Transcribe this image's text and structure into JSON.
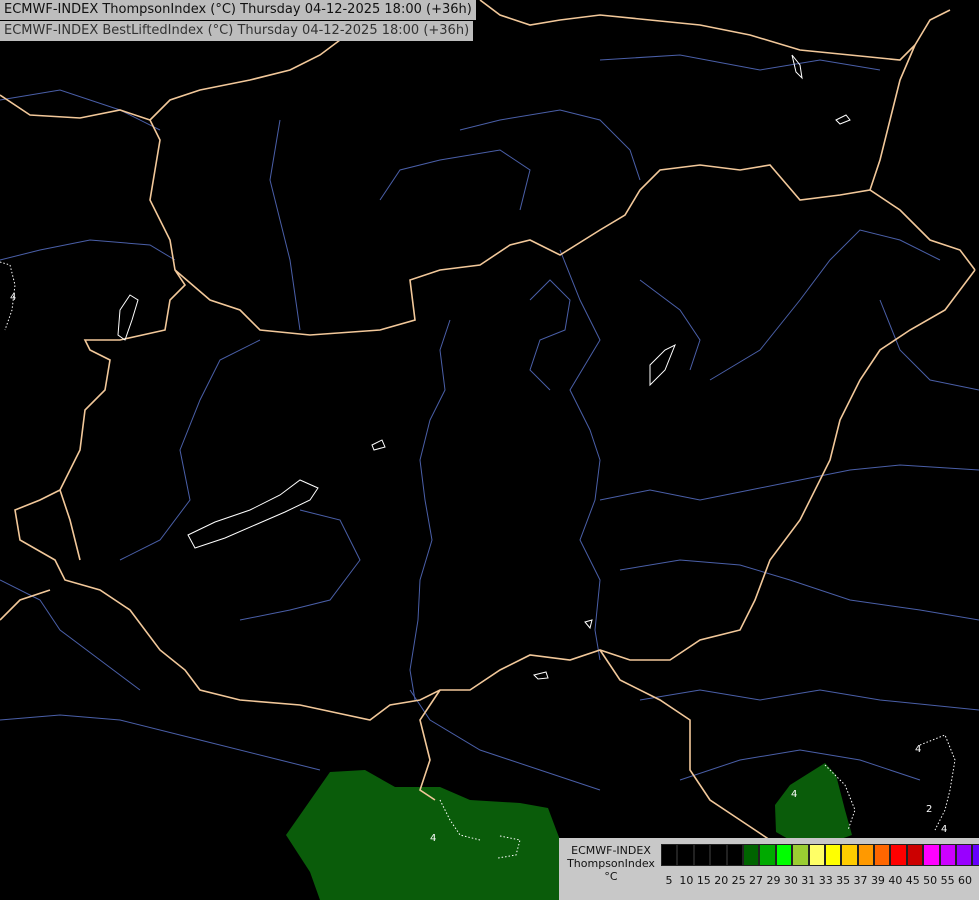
{
  "titles": {
    "line1": "ECMWF-INDEX ThompsonIndex (°C) Thursday 04-12-2025 18:00 (+36h)",
    "line2": "ECMWF-INDEX BestLiftedIndex (°C) Thursday 04-12-2025 18:00 (+36h)"
  },
  "legend": {
    "line1": "ECMWF-INDEX",
    "line2": "ThompsonIndex",
    "line3": "°C",
    "colors": [
      "#000000",
      "#000000",
      "#000000",
      "#000000",
      "#000000",
      "#006400",
      "#00aa00",
      "#00ff00",
      "#9acd32",
      "#ffff66",
      "#ffff00",
      "#ffcc00",
      "#ff9900",
      "#ff6600",
      "#ff0000",
      "#cc0000",
      "#ff00ff",
      "#cc00ff",
      "#9900ff",
      "#6600ff",
      "#0000ff"
    ],
    "ticks": [
      "5",
      "10",
      "15",
      "20",
      "25",
      "27",
      "29",
      "30",
      "31",
      "33",
      "35",
      "37",
      "39",
      "40",
      "45",
      "50",
      "55",
      "60"
    ]
  },
  "contour_labels": [
    "4",
    "4",
    "4",
    "4",
    "2",
    "4"
  ]
}
